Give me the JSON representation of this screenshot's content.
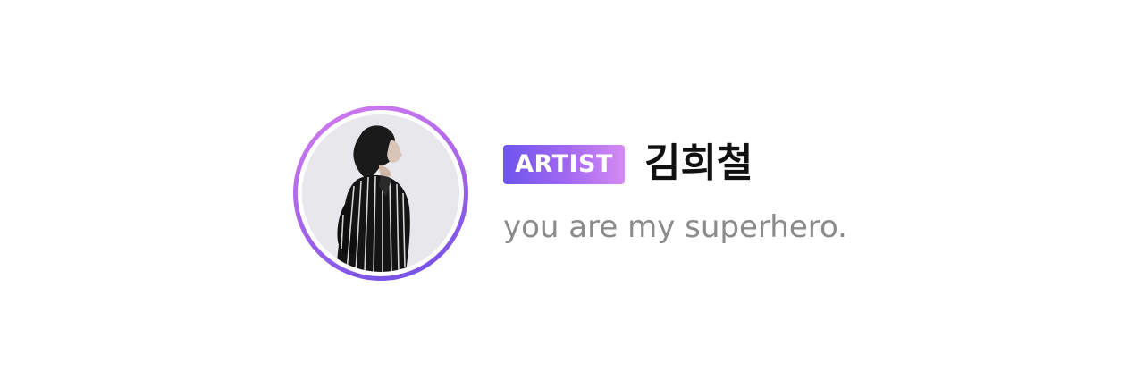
{
  "profile": {
    "badge_label": "ARTIST",
    "name": "김희철",
    "status_message": "you are my superhero."
  },
  "colors": {
    "ring_gradient": [
      "#d57cf0",
      "#a766ea",
      "#6a4ee6"
    ],
    "badge_gradient": [
      "#6e54ee",
      "#a46af0",
      "#d58af5"
    ],
    "name_text": "#111111",
    "status_text": "#8b8b8b"
  },
  "icons": {
    "avatar": "profile-photo"
  }
}
